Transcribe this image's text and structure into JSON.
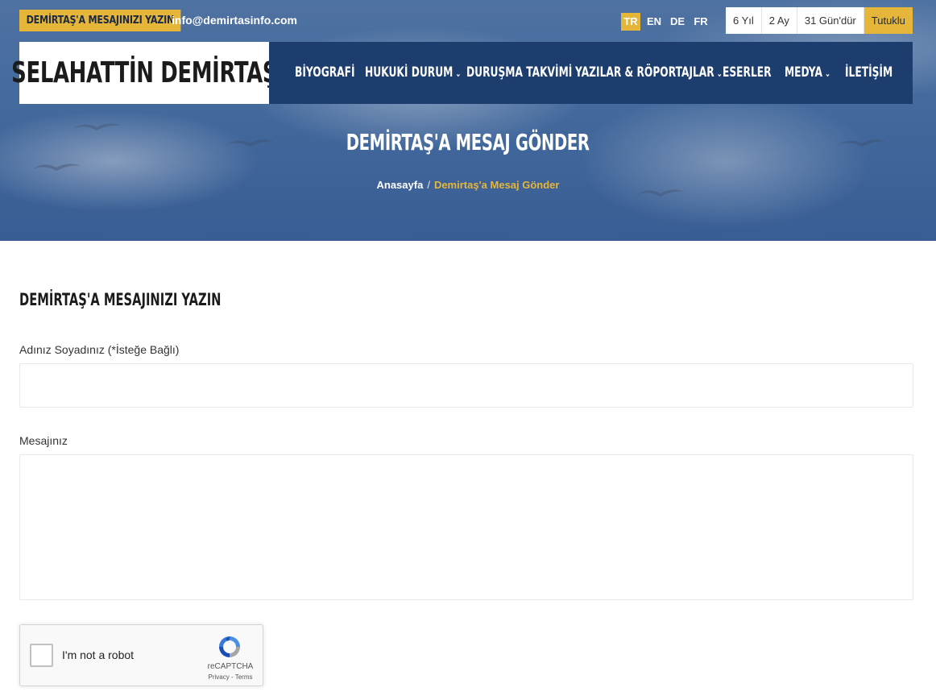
{
  "topbar": {
    "badge": "DEMİRTAŞ'A MESAJINIZI YAZIN",
    "email": "info@demirtasinfo.com",
    "languages": [
      "TR",
      "EN",
      "DE",
      "FR"
    ],
    "active_language": "TR",
    "counter": [
      "6 Yıl",
      "2 Ay",
      "31 Gün'dür",
      "Tutuklu"
    ]
  },
  "header": {
    "logo": "SELAHATTİN DEMİRTAŞ",
    "nav": [
      {
        "label": "BİYOGRAFİ",
        "has_dropdown": false
      },
      {
        "label": "HUKUKİ DURUM",
        "has_dropdown": true
      },
      {
        "label": "DURUŞMA TAKVİMİ",
        "has_dropdown": false
      },
      {
        "label": "YAZILAR & RÖPORTAJLAR",
        "has_dropdown": true
      },
      {
        "label": "ESERLER",
        "has_dropdown": false
      },
      {
        "label": "MEDYA",
        "has_dropdown": true
      },
      {
        "label": "İLETİŞİM",
        "has_dropdown": false
      }
    ]
  },
  "hero": {
    "title": "DEMİRTAŞ'A MESAJ GÖNDER",
    "breadcrumb": {
      "home": "Anasayfa",
      "separator": "/",
      "current": "Demirtaş'a Mesaj Gönder"
    }
  },
  "form": {
    "heading": "DEMİRTAŞ'A MESAJINIZI YAZIN",
    "name_label": "Adınız Soyadınız (*İsteğe Bağlı)",
    "name_value": "",
    "message_label": "Mesajınız",
    "message_value": ""
  },
  "recaptcha": {
    "label": "I'm not a robot",
    "brand": "reCAPTCHA",
    "links": "Privacy - Terms",
    "checked": false
  },
  "colors": {
    "accent": "#e6b63a",
    "navy": "#1c3d6e"
  }
}
